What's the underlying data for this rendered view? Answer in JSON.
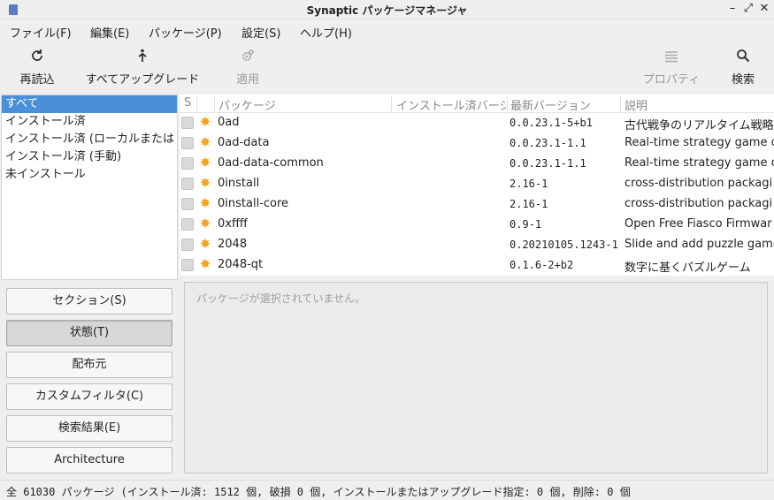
{
  "window": {
    "title": "Synaptic パッケージマネージャ",
    "minimize_glyph": "–",
    "maximize_glyph": "⤢",
    "close_glyph": "✕"
  },
  "menu": [
    "ファイル(F)",
    "編集(E)",
    "パッケージ(P)",
    "設定(S)",
    "ヘルプ(H)"
  ],
  "toolbar": {
    "reload": "再読込",
    "upgrade_all": "すべてアップグレード",
    "apply": "適用",
    "properties": "プロパティ",
    "search": "検索"
  },
  "filters": [
    "すべて",
    "インストール済",
    "インストール済 (ローカルまたは",
    "インストール済 (手動)",
    "未インストール"
  ],
  "side_buttons": [
    "セクション(S)",
    "状態(T)",
    "配布元",
    "カスタムフィルタ(C)",
    "検索結果(E)",
    "Architecture"
  ],
  "columns": {
    "status": "S",
    "package": "パッケージ",
    "installed_version": "インストール済バージョン",
    "latest_version": "最新バージョン",
    "description": "説明"
  },
  "packages": [
    {
      "name": "0ad",
      "latest": "0.0.23.1-5+b1",
      "desc": "古代戦争のリアルタイム戦略"
    },
    {
      "name": "0ad-data",
      "latest": "0.0.23.1-1.1",
      "desc": "Real-time strategy game o"
    },
    {
      "name": "0ad-data-common",
      "latest": "0.0.23.1-1.1",
      "desc": "Real-time strategy game o"
    },
    {
      "name": "0install",
      "latest": "2.16-1",
      "desc": "cross-distribution packagi"
    },
    {
      "name": "0install-core",
      "latest": "2.16-1",
      "desc": "cross-distribution packagi"
    },
    {
      "name": "0xffff",
      "latest": "0.9-1",
      "desc": "Open Free Fiasco Firmwar"
    },
    {
      "name": "2048",
      "latest": "0.20210105.1243-1",
      "desc": "Slide and add puzzle game"
    },
    {
      "name": "2048-qt",
      "latest": "0.1.6-2+b2",
      "desc": "数字に基くパズルゲーム"
    }
  ],
  "detail": {
    "placeholder": "パッケージが選択されていません。"
  },
  "status_bar": "全 61030 パッケージ (インストール済: 1512 個, 破損 0 個, インストールまたはアップグレード指定: 0 個, 削除: 0 個"
}
